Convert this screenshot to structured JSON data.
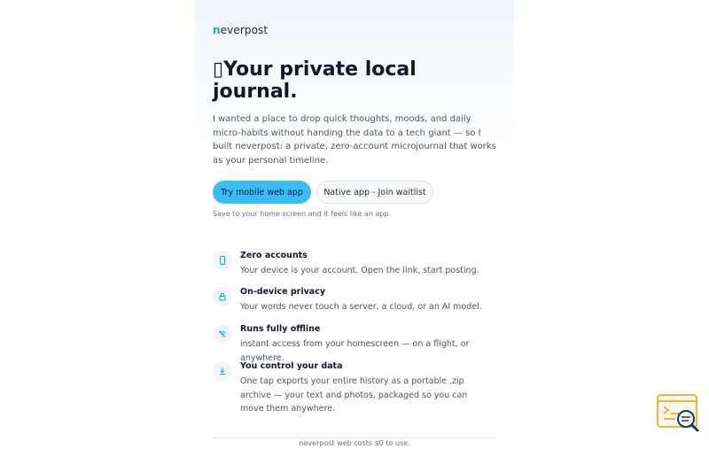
{
  "brand": {
    "first_letter": "n",
    "rest": "everpost"
  },
  "hero": {
    "title_glyph": "▯",
    "title": "Your private local journal.",
    "intro": "I wanted a place to drop quick thoughts, moods, and daily micro-habits without handing the data to a tech giant — so I built neverpost: a private, zero-account microjournal that works as your personal timeline."
  },
  "actions": {
    "primary_label": "Try mobile web app",
    "secondary_label": "Native app - Join waitlist",
    "hint": "Save to your home screen and it feels like an app."
  },
  "features": [
    {
      "icon": "phone-icon",
      "title": "Zero accounts",
      "desc": "Your device is your account. Open the link, start posting."
    },
    {
      "icon": "lock-icon",
      "title": "On-device privacy",
      "desc": "Your words never touch a server, a cloud, or an AI model."
    },
    {
      "icon": "wifi-off-icon",
      "title": "Runs fully offline",
      "desc": "instant access from your homescreen — on a flight, or anywhere."
    },
    {
      "icon": "download-icon",
      "title": "You control your data",
      "desc": "One tap exports your entire history as a portable .zip archive — your text and photos, packaged so you can move them anywhere."
    }
  ],
  "footer": {
    "text": "neverpost web costs $0 to use."
  },
  "colors": {
    "accent": "#38bdf8",
    "brand": "#0ea5e9",
    "icon_stroke": "#0ea5e9"
  }
}
